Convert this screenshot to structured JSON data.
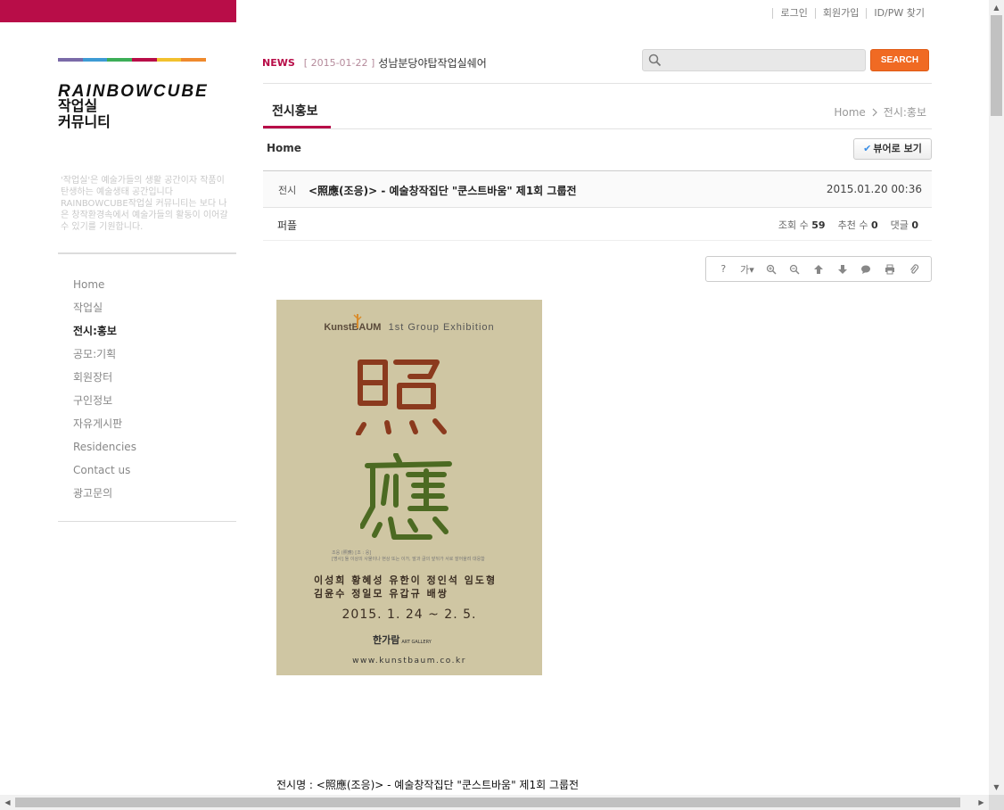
{
  "top_links": [
    "로그인",
    "회원가입",
    "ID/PW 찾기"
  ],
  "sidebar": {
    "logo_en": "RAINBOWCUBE",
    "logo_kr_line1": "작업실",
    "logo_kr_line2": "커뮤니티",
    "intro": "'작업실'은 예술가들의 생활 공간이자 작품이 탄생하는 예술생태 공간입니다 RAINBOWCUBE작업실 커뮤니티는 보다 나은 창작환경속에서 예술가들의 활동이 이어갈 수 있기를 기원합니다.",
    "rainbow_colors": [
      "#7a6aa8",
      "#3d9bd4",
      "#3cae57",
      "#b80d48",
      "#f2c12e",
      "#ef8a2d"
    ],
    "nav": [
      "Home",
      "작업실",
      "전시:홍보",
      "공모:기획",
      "회원장터",
      "구인정보",
      "자유게시판",
      "Residencies",
      "Contact us",
      "광고문의"
    ],
    "active_nav": "전시:홍보"
  },
  "header": {
    "news_label": "NEWS",
    "news_date": "[ 2015-01-22 ]",
    "news_title": "성남분당야탑작업실쉐어",
    "search_placeholder": "",
    "search_button": "SEARCH"
  },
  "board": {
    "title": "전시홍보",
    "breadcrumb_home": "Home",
    "breadcrumb_current": "전시:홍보",
    "home_label": "Home",
    "viewer_button": "뷰어로 보기"
  },
  "post": {
    "category": "전시",
    "title": "<照應(조응)> - 예술창작집단 \"쿤스트바움\" 제1회 그룹전",
    "datetime": "2015.01.20 00:36",
    "author": "퍼플",
    "views_label": "조회 수",
    "views": "59",
    "recommend_label": "추천 수",
    "recommend": "0",
    "comments_label": "댓글",
    "comments": "0"
  },
  "toolbar": {
    "help": "?",
    "font": "가▾"
  },
  "poster": {
    "brand": "KunstBAUM",
    "heading": "1st Group Exhibition",
    "sub_line1": "조응 (照應) [조 : 응]",
    "sub_line2": "[명사] 둘 이상의 사물이나 현상 또는 이가, 말과 글의 앞뒤가 서로 잘어울려 대응함",
    "names_line1": "이성희  황혜성  유한이  정인석  임도형",
    "names_line2": "김윤수  정일모  유갑규  배쌍",
    "dates": "2015. 1. 24 ~ 2. 5.",
    "gallery": "한가람",
    "gallery_sub": "ART GALLERY",
    "url": "www.kunstbaum.co.kr",
    "background_color": "#cfc6a3"
  },
  "caption": "전시명 : <照應(조응)> - 예술창작집단 \"쿤스트바움\" 제1회 그룹전"
}
